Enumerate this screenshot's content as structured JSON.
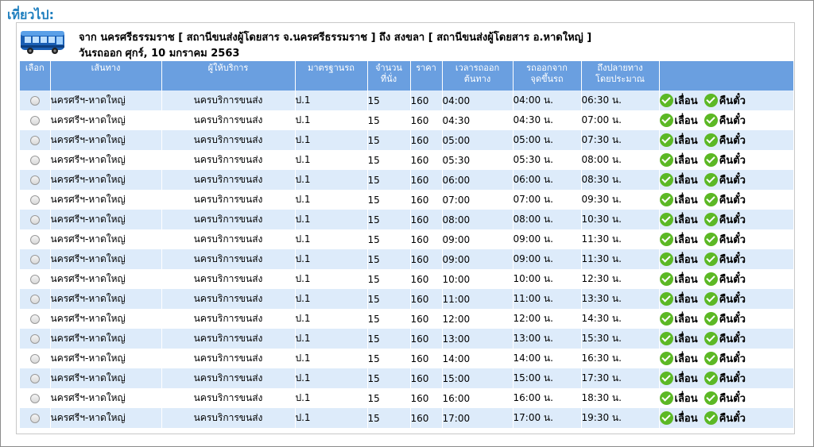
{
  "section_title": "เที่ยวไป:",
  "trip": {
    "route_text": "จาก นครศรีธรรมราช [ สถานีขนส่งผู้โดยสาร จ.นครศรีธรรมราช ] ถึง สงขลา [ สถานีขนส่งผู้โดยสาร อ.หาดใหญ่ ]",
    "date_label": "วันรถออก",
    "date_value": "ศุกร์, 10 มกราคม 2563",
    "bus_icon": "bus-icon"
  },
  "columns": {
    "select": "เลือก",
    "route": "เส้นทาง",
    "provider": "ผู้ให้บริการ",
    "standard": "มาตรฐานรถ",
    "seats_line1": "จำนวน",
    "seats_line2": "ที่นั่ง",
    "price": "ราคา",
    "time_line1": "เวลารถออก",
    "time_line2": "ต้นทาง",
    "depart_line1": "รถออกจาก",
    "depart_line2": "จุดขึ้นรถ",
    "arrive_line1": "ถึงปลายทาง",
    "arrive_line2": "โดยประมาณ",
    "actions": ""
  },
  "colors": {
    "header_bg": "#6a9fe0",
    "row_alt_bg": "#ddebfa",
    "title_color": "#1f7fbf",
    "check_green": "#5cb825"
  },
  "rows": [
    {
      "route": "นครศรีฯ-หาดใหญ่",
      "provider": "นครบริการขนส่ง",
      "standard": "ป.1",
      "seats": "15",
      "price": "160",
      "time": "04:00",
      "depart": "04:00 น.",
      "arrive": "06:30 น.",
      "postpone": "เลื่อน",
      "refund": "คืนตั๋ว"
    },
    {
      "route": "นครศรีฯ-หาดใหญ่",
      "provider": "นครบริการขนส่ง",
      "standard": "ป.1",
      "seats": "15",
      "price": "160",
      "time": "04:30",
      "depart": "04:30 น.",
      "arrive": "07:00 น.",
      "postpone": "เลื่อน",
      "refund": "คืนตั๋ว"
    },
    {
      "route": "นครศรีฯ-หาดใหญ่",
      "provider": "นครบริการขนส่ง",
      "standard": "ป.1",
      "seats": "15",
      "price": "160",
      "time": "05:00",
      "depart": "05:00 น.",
      "arrive": "07:30 น.",
      "postpone": "เลื่อน",
      "refund": "คืนตั๋ว"
    },
    {
      "route": "นครศรีฯ-หาดใหญ่",
      "provider": "นครบริการขนส่ง",
      "standard": "ป.1",
      "seats": "15",
      "price": "160",
      "time": "05:30",
      "depart": "05:30 น.",
      "arrive": "08:00 น.",
      "postpone": "เลื่อน",
      "refund": "คืนตั๋ว"
    },
    {
      "route": "นครศรีฯ-หาดใหญ่",
      "provider": "นครบริการขนส่ง",
      "standard": "ป.1",
      "seats": "15",
      "price": "160",
      "time": "06:00",
      "depart": "06:00 น.",
      "arrive": "08:30 น.",
      "postpone": "เลื่อน",
      "refund": "คืนตั๋ว"
    },
    {
      "route": "นครศรีฯ-หาดใหญ่",
      "provider": "นครบริการขนส่ง",
      "standard": "ป.1",
      "seats": "15",
      "price": "160",
      "time": "07:00",
      "depart": "07:00 น.",
      "arrive": "09:30 น.",
      "postpone": "เลื่อน",
      "refund": "คืนตั๋ว"
    },
    {
      "route": "นครศรีฯ-หาดใหญ่",
      "provider": "นครบริการขนส่ง",
      "standard": "ป.1",
      "seats": "15",
      "price": "160",
      "time": "08:00",
      "depart": "08:00 น.",
      "arrive": "10:30 น.",
      "postpone": "เลื่อน",
      "refund": "คืนตั๋ว"
    },
    {
      "route": "นครศรีฯ-หาดใหญ่",
      "provider": "นครบริการขนส่ง",
      "standard": "ป.1",
      "seats": "15",
      "price": "160",
      "time": "09:00",
      "depart": "09:00 น.",
      "arrive": "11:30 น.",
      "postpone": "เลื่อน",
      "refund": "คืนตั๋ว"
    },
    {
      "route": "นครศรีฯ-หาดใหญ่",
      "provider": "นครบริการขนส่ง",
      "standard": "ป.1",
      "seats": "15",
      "price": "160",
      "time": "09:00",
      "depart": "09:00 น.",
      "arrive": "11:30 น.",
      "postpone": "เลื่อน",
      "refund": "คืนตั๋ว"
    },
    {
      "route": "นครศรีฯ-หาดใหญ่",
      "provider": "นครบริการขนส่ง",
      "standard": "ป.1",
      "seats": "15",
      "price": "160",
      "time": "10:00",
      "depart": "10:00 น.",
      "arrive": "12:30 น.",
      "postpone": "เลื่อน",
      "refund": "คืนตั๋ว"
    },
    {
      "route": "นครศรีฯ-หาดใหญ่",
      "provider": "นครบริการขนส่ง",
      "standard": "ป.1",
      "seats": "15",
      "price": "160",
      "time": "11:00",
      "depart": "11:00 น.",
      "arrive": "13:30 น.",
      "postpone": "เลื่อน",
      "refund": "คืนตั๋ว"
    },
    {
      "route": "นครศรีฯ-หาดใหญ่",
      "provider": "นครบริการขนส่ง",
      "standard": "ป.1",
      "seats": "15",
      "price": "160",
      "time": "12:00",
      "depart": "12:00 น.",
      "arrive": "14:30 น.",
      "postpone": "เลื่อน",
      "refund": "คืนตั๋ว"
    },
    {
      "route": "นครศรีฯ-หาดใหญ่",
      "provider": "นครบริการขนส่ง",
      "standard": "ป.1",
      "seats": "15",
      "price": "160",
      "time": "13:00",
      "depart": "13:00 น.",
      "arrive": "15:30 น.",
      "postpone": "เลื่อน",
      "refund": "คืนตั๋ว"
    },
    {
      "route": "นครศรีฯ-หาดใหญ่",
      "provider": "นครบริการขนส่ง",
      "standard": "ป.1",
      "seats": "15",
      "price": "160",
      "time": "14:00",
      "depart": "14:00 น.",
      "arrive": "16:30 น.",
      "postpone": "เลื่อน",
      "refund": "คืนตั๋ว"
    },
    {
      "route": "นครศรีฯ-หาดใหญ่",
      "provider": "นครบริการขนส่ง",
      "standard": "ป.1",
      "seats": "15",
      "price": "160",
      "time": "15:00",
      "depart": "15:00 น.",
      "arrive": "17:30 น.",
      "postpone": "เลื่อน",
      "refund": "คืนตั๋ว"
    },
    {
      "route": "นครศรีฯ-หาดใหญ่",
      "provider": "นครบริการขนส่ง",
      "standard": "ป.1",
      "seats": "15",
      "price": "160",
      "time": "16:00",
      "depart": "16:00 น.",
      "arrive": "18:30 น.",
      "postpone": "เลื่อน",
      "refund": "คืนตั๋ว"
    },
    {
      "route": "นครศรีฯ-หาดใหญ่",
      "provider": "นครบริการขนส่ง",
      "standard": "ป.1",
      "seats": "15",
      "price": "160",
      "time": "17:00",
      "depart": "17:00 น.",
      "arrive": "19:30 น.",
      "postpone": "เลื่อน",
      "refund": "คืนตั๋ว"
    }
  ]
}
